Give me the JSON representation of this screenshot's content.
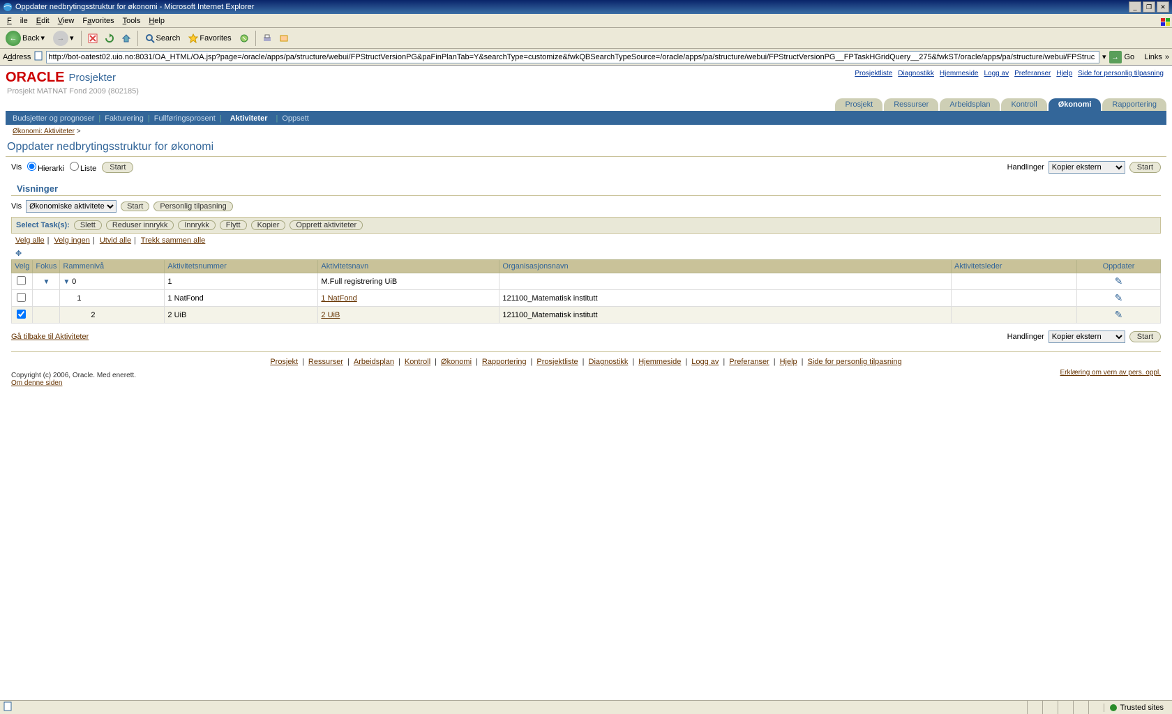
{
  "window": {
    "title": "Oppdater nedbrytingsstruktur for økonomi - Microsoft Internet Explorer",
    "min": "_",
    "restore": "❐",
    "close": "✕"
  },
  "menubar": {
    "file": "File",
    "edit": "Edit",
    "view": "View",
    "favorites": "Favorites",
    "tools": "Tools",
    "help": "Help"
  },
  "ietoolbar": {
    "back": "Back",
    "search": "Search",
    "favorites": "Favorites"
  },
  "addrbar": {
    "label": "Address",
    "url": "http://bot-oatest02.uio.no:8031/OA_HTML/OA.jsp?page=/oracle/apps/pa/structure/webui/FPStructVersionPG&paFinPlanTab=Y&searchType=customize&fwkQBSearchTypeSource=/oracle/apps/pa/structure/webui/FPStructVersionPG__FPTaskHGridQuery__275&fwkST/oracle/apps/pa/structure/webui/FPStruc",
    "go": "Go",
    "links": "Links"
  },
  "app": {
    "logo": "ORACLE",
    "name": "Prosjekter",
    "project": "Prosjekt MATNAT Fond 2009 (802185)"
  },
  "headerLinks": [
    "Prosjektliste",
    "Diagnostikk",
    "Hjemmeside",
    "Logg av",
    "Preferanser",
    "Hjelp",
    "Side for personlig tilpasning"
  ],
  "tabs": [
    "Prosjekt",
    "Ressurser",
    "Arbeidsplan",
    "Kontroll",
    "Økonomi",
    "Rapportering"
  ],
  "activeTab": "Økonomi",
  "subtabs": [
    "Budsjetter og prognoser",
    "Fakturering",
    "Fullføringsprosent",
    "Aktiviteter",
    "Oppsett"
  ],
  "activeSubtab": "Aktiviteter",
  "breadcrumb": {
    "link": "Økonomi: Aktiviteter",
    "sep": ">"
  },
  "pageTitle": "Oppdater nedbrytingsstruktur for økonomi",
  "vis": {
    "label": "Vis",
    "hierarki": "Hierarki",
    "liste": "Liste",
    "start": "Start"
  },
  "handlinger": {
    "label": "Handlinger",
    "selected": "Kopier ekstern",
    "options": [
      "Kopier ekstern"
    ],
    "start": "Start"
  },
  "visninger": {
    "title": "Visninger",
    "visLabel": "Vis",
    "selected": "Økonomiske aktiviteter",
    "options": [
      "Økonomiske aktiviteter"
    ],
    "start": "Start",
    "tilpasning": "Personlig tilpasning"
  },
  "taskbar": {
    "label": "Select Task(s):",
    "slett": "Slett",
    "reduser": "Reduser innrykk",
    "innrykk": "Innrykk",
    "flytt": "Flytt",
    "kopier": "Kopier",
    "opprett": "Opprett aktiviteter"
  },
  "selectLinks": {
    "alle": "Velg alle",
    "ingen": "Velg ingen",
    "utvid": "Utvid alle",
    "trekk": "Trekk sammen alle"
  },
  "columns": {
    "velg": "Velg",
    "fokus": "Fokus",
    "ramme": "Rammenivå",
    "nummer": "Aktivitetsnummer",
    "navn": "Aktivitetsnavn",
    "org": "Organisasjonsnavn",
    "leder": "Aktivitetsleder",
    "oppdater": "Oppdater"
  },
  "rows": [
    {
      "checked": false,
      "focus": true,
      "ramme": "0",
      "nummer": "1",
      "navn": "M.Full registrering UiB",
      "navnLink": false,
      "org": "",
      "alt": false
    },
    {
      "checked": false,
      "focus": false,
      "ramme": "1",
      "nummer": "1 NatFond",
      "navn": "1 NatFond",
      "navnLink": true,
      "org": "121100_Matematisk institutt",
      "alt": false
    },
    {
      "checked": true,
      "focus": false,
      "ramme": "2",
      "nummer": "2 UiB",
      "navn": "2 UiB",
      "navnLink": true,
      "org": "121100_Matematisk institutt",
      "alt": true
    }
  ],
  "backLink": "Gå tilbake til Aktiviteter",
  "footerLinks": [
    "Prosjekt",
    "Ressurser",
    "Arbeidsplan",
    "Kontroll",
    "Økonomi",
    "Rapportering",
    "Prosjektliste",
    "Diagnostikk",
    "Hjemmeside",
    "Logg av",
    "Preferanser",
    "Hjelp",
    "Side for personlig tilpasning"
  ],
  "copyright": "Copyright (c) 2006, Oracle. Med enerett.",
  "aboutLink": "Om denne siden",
  "privacy": "Erklæring om vern av pers. oppl.",
  "statusbar": {
    "trusted": "Trusted sites"
  }
}
